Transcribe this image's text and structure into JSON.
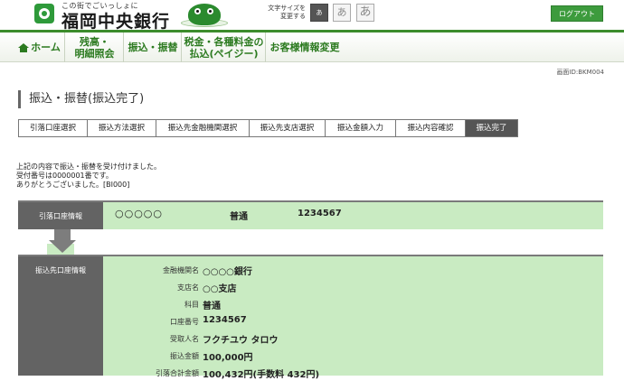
{
  "header": {
    "logo_tagline": "この街でごいっしょに",
    "bank_name": "福岡中央銀行",
    "font_size_label_line1": "文字サイズを",
    "font_size_label_line2": "変更する",
    "font_sizes": [
      "あ",
      "あ",
      "あ"
    ],
    "logout_label": "ログアウト"
  },
  "nav": {
    "home": "ホーム",
    "balance_line1": "残高・",
    "balance_line2": "明細照会",
    "transfer": "振込・振替",
    "tax_line1": "税金・各種料金の",
    "tax_line2": "払込(ペイジー)",
    "customer_info": "お客様情報変更"
  },
  "screen_id": "画面ID:BKM004",
  "page_title": "振込・振替(振込完了)",
  "steps": [
    "引落口座選択",
    "振込方法選択",
    "振込先金融機関選択",
    "振込先支店選択",
    "振込金額入力",
    "振込内容確認",
    "振込完了"
  ],
  "message": {
    "line1": "上記の内容で振込・振替を受け付けました。",
    "line2": "受付番号は0000001番です。",
    "line3": "ありがとうございました。[BI000]"
  },
  "from_account": {
    "label": "引落口座情報",
    "name": "○○○○○",
    "type": "普通",
    "number": "1234567"
  },
  "to_account": {
    "label": "振込先口座情報",
    "rows": [
      {
        "label": "金融機関名",
        "value": "○○○○銀行"
      },
      {
        "label": "支店名",
        "value": "○○支店"
      },
      {
        "label": "科目",
        "value": "普通"
      },
      {
        "label": "口座番号",
        "value": "1234567"
      },
      {
        "label": "受取人名",
        "value": "フクチユウ タロウ"
      },
      {
        "label": "振込金額",
        "value": "100,000円"
      },
      {
        "label": "引落合計金額",
        "value": "100,432円(手数料 432円)"
      }
    ]
  },
  "colors": {
    "brand_green": "#3d9b3d",
    "nav_text_green": "#2b7a1f",
    "info_bg": "#c9ebc2",
    "label_bg": "#636363"
  }
}
